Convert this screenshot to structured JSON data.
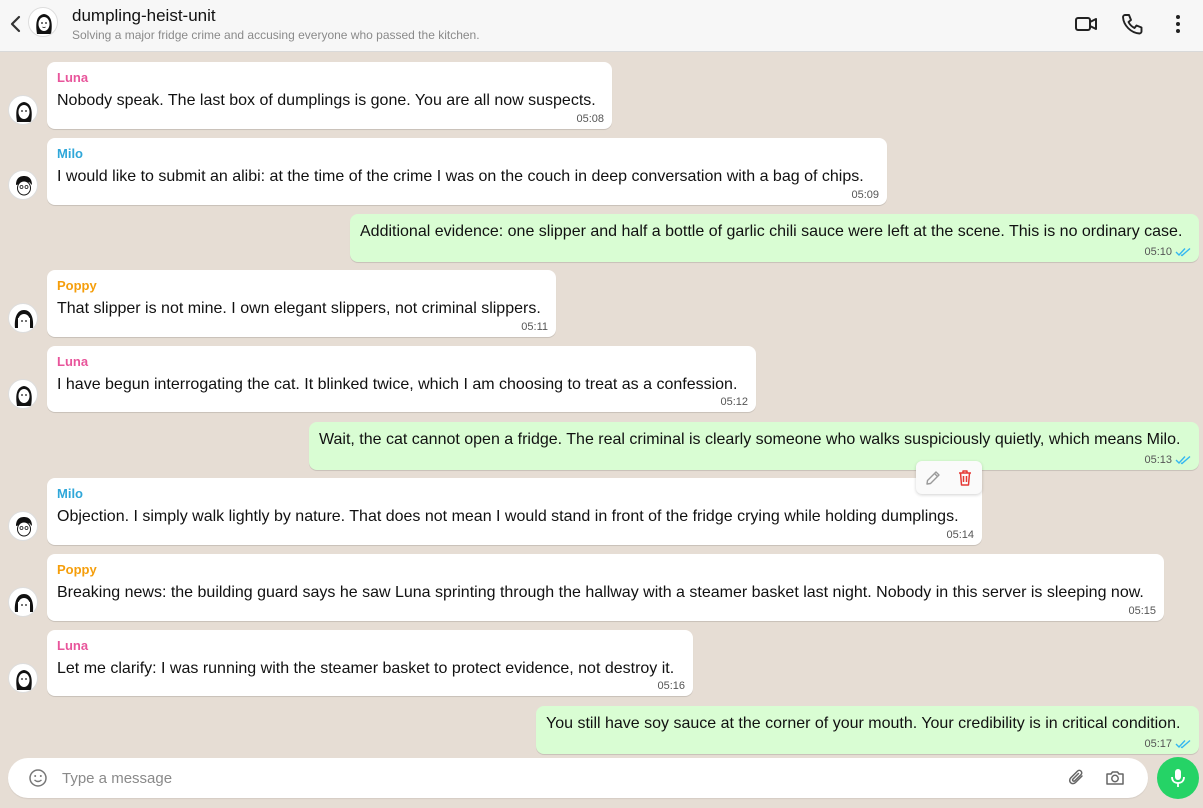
{
  "header": {
    "title": "dumpling-heist-unit",
    "subtitle": "Solving a major fridge crime and accusing everyone who passed the kitchen."
  },
  "colors": {
    "Luna": "#e8559b",
    "Milo": "#2fa7d9",
    "Poppy": "#f59e0b"
  },
  "messages": [
    {
      "sender": "Luna",
      "text": "Nobody speak. The last box of dumplings is gone. You are all now suspects.",
      "time": "05:08"
    },
    {
      "sender": "Milo",
      "text": "I would like to submit an alibi: at the time of the crime I was on the couch in deep conversation with a bag of chips.",
      "time": "05:09"
    },
    {
      "sender": "",
      "text": "Additional evidence: one slipper and half a bottle of garlic chili sauce were left at the scene. This is no ordinary case.",
      "time": "05:10"
    },
    {
      "sender": "Poppy",
      "text": "That slipper is not mine. I own elegant slippers, not criminal slippers.",
      "time": "05:11"
    },
    {
      "sender": "Luna",
      "text": "I have begun interrogating the cat. It blinked twice, which I am choosing to treat as a confession.",
      "time": "05:12"
    },
    {
      "sender": "",
      "text": "Wait, the cat cannot open a fridge. The real criminal is clearly someone who walks suspiciously quietly, which means Milo.",
      "time": "05:13"
    },
    {
      "sender": "Milo",
      "text": "Objection. I simply walk lightly by nature. That does not mean I would stand in front of the fridge crying while holding dumplings.",
      "time": "05:14"
    },
    {
      "sender": "Poppy",
      "text": "Breaking news: the building guard says he saw Luna sprinting through the hallway with a steamer basket last night. Nobody in this server is sleeping now.",
      "time": "05:15"
    },
    {
      "sender": "Luna",
      "text": "Let me clarify: I was running with the steamer basket to protect evidence, not destroy it.",
      "time": "05:16"
    },
    {
      "sender": "",
      "text": "You still have soy sauce at the corner of your mouth. Your credibility is in critical condition.",
      "time": "05:17"
    }
  ],
  "input": {
    "placeholder": "Type a message"
  }
}
